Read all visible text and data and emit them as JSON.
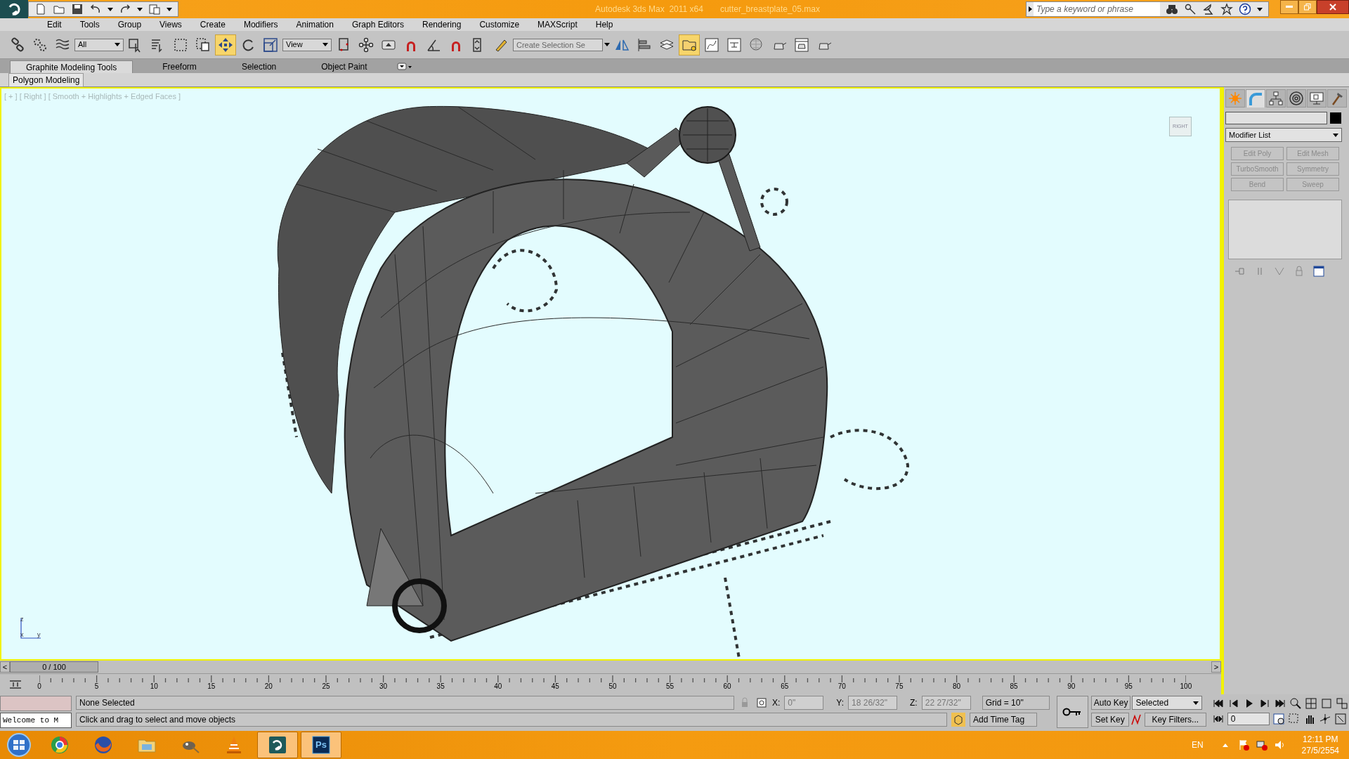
{
  "title_bar": {
    "app_title": "Autodesk 3ds Max  2011 x64",
    "file_name": "cutter_breastplate_05.max",
    "search": {
      "placeholder": "Type a keyword or phrase"
    }
  },
  "menu": [
    "Edit",
    "Tools",
    "Group",
    "Views",
    "Create",
    "Modifiers",
    "Animation",
    "Graph Editors",
    "Rendering",
    "Customize",
    "MAXScript",
    "Help"
  ],
  "toolbar": [
    {
      "kind": "link",
      "active": false
    },
    {
      "kind": "unlink",
      "active": false
    },
    {
      "kind": "wave",
      "active": false
    },
    {
      "kind": "dropdown",
      "value": "All"
    },
    {
      "kind": "cursor",
      "active": false
    },
    {
      "kind": "list",
      "active": false
    },
    {
      "kind": "rect",
      "active": false
    },
    {
      "kind": "crossing",
      "active": false
    },
    {
      "kind": "move",
      "active": true
    },
    {
      "kind": "rotate",
      "active": false
    },
    {
      "kind": "scale",
      "active": false
    },
    {
      "kind": "dropdown",
      "value": "View"
    },
    {
      "kind": "pivot",
      "active": false
    },
    {
      "kind": "nodes",
      "active": false
    },
    {
      "kind": "keyboard",
      "active": false
    },
    {
      "kind": "magnet",
      "active": false
    },
    {
      "kind": "angle",
      "active": false
    },
    {
      "kind": "magnet",
      "active": false
    },
    {
      "kind": "spinner",
      "active": false
    },
    {
      "kind": "pencil",
      "active": false
    },
    {
      "kind": "named",
      "placeholder": "Create Selection Se"
    },
    {
      "kind": "mirror",
      "active": false
    },
    {
      "kind": "align",
      "active": false
    },
    {
      "kind": "layers",
      "active": false
    },
    {
      "kind": "folder",
      "active": true
    },
    {
      "kind": "curve",
      "active": false
    },
    {
      "kind": "schematic",
      "active": false
    },
    {
      "kind": "sphere",
      "active": false
    },
    {
      "kind": "teapot",
      "active": false
    },
    {
      "kind": "frame",
      "active": false
    },
    {
      "kind": "teapot",
      "active": false
    }
  ],
  "ribbon": {
    "tabs": [
      {
        "label": "Graphite Modeling Tools",
        "selected": true
      },
      {
        "label": "Freeform",
        "selected": false
      },
      {
        "label": "Selection",
        "selected": false
      },
      {
        "label": "Object Paint",
        "selected": false
      }
    ],
    "panel": "Polygon Modeling"
  },
  "viewport": {
    "label": "[ + ] [ Right ] [ Smooth + Highlights + Edged Faces ]",
    "viewcube": "RIGHT",
    "axes": [
      "z",
      "x",
      "y"
    ]
  },
  "command_panel": {
    "tabs": [
      {
        "kind": "create",
        "selected": false
      },
      {
        "kind": "modify",
        "selected": true
      },
      {
        "kind": "hierarchy",
        "selected": false
      },
      {
        "kind": "motion",
        "selected": false
      },
      {
        "kind": "display",
        "selected": false
      },
      {
        "kind": "utilities",
        "selected": false
      }
    ],
    "modifier_list": "Modifier List",
    "buttons": [
      {
        "label": "Edit Poly",
        "disabled": true
      },
      {
        "label": "Edit Mesh",
        "disabled": true
      },
      {
        "label": "TurboSmooth",
        "disabled": true
      },
      {
        "label": "Symmetry",
        "disabled": true
      },
      {
        "label": "Bend",
        "disabled": true
      },
      {
        "label": "Sweep",
        "disabled": true
      }
    ]
  },
  "timeline": {
    "frame": "0 / 100",
    "prev": "<",
    "next": ">",
    "ticks": [
      "0",
      "5",
      "10",
      "15",
      "20",
      "25",
      "30",
      "35",
      "40",
      "45",
      "50",
      "55",
      "60",
      "65",
      "70",
      "75",
      "80",
      "85",
      "90",
      "95",
      "100"
    ]
  },
  "status": {
    "maxscript": "Welcome to M",
    "selection": "None Selected",
    "prompt": "Click and drag to select and move objects",
    "x_label": "X:",
    "x": "0\"",
    "y_label": "Y:",
    "y": "18 26/32\"",
    "z_label": "Z:",
    "z": "22 27/32\"",
    "grid": "Grid = 10\"",
    "add_time_tag": "Add Time Tag",
    "auto_key": "Auto Key",
    "set_key": "Set Key",
    "key_mode": "Selected",
    "key_filters": "Key Filters...",
    "current_frame": "0"
  },
  "taskbar": {
    "apps": [
      {
        "kind": "chrome",
        "running": false
      },
      {
        "kind": "firefox",
        "running": false
      },
      {
        "kind": "explorer",
        "running": false
      },
      {
        "kind": "gimp",
        "running": false
      },
      {
        "kind": "vlc",
        "running": false
      },
      {
        "kind": "max",
        "running": true
      },
      {
        "kind": "photoshop",
        "running": true,
        "label": "Ps"
      }
    ],
    "language": "EN",
    "time": "12:11 PM",
    "date": "27/5/2554"
  }
}
